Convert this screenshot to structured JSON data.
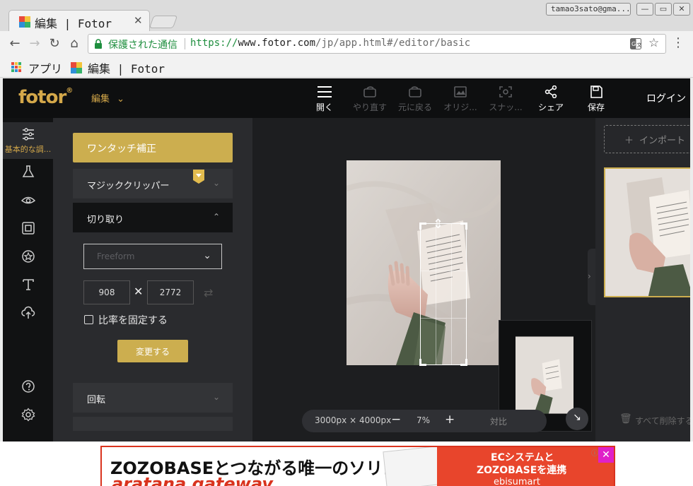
{
  "browser": {
    "tab_title": "編集 | Fotor",
    "tab_close": "✕",
    "user": "tamao3sato@gma...",
    "window_buttons": [
      "—",
      "▭",
      "✕"
    ],
    "secure_label": "保護された通信",
    "url_scheme": "https://",
    "url_host": "www.fotor.com",
    "url_path": "/jp/app.html#/editor/basic",
    "bookmarks": {
      "apps_label": "アプリ",
      "fotor_label": "編集 | Fotor"
    }
  },
  "app": {
    "logo": "fotor",
    "logo_mark": "®",
    "edit_menu": "編集",
    "toolbar": [
      {
        "label": "開く",
        "icon": "menu-icon",
        "enabled": true
      },
      {
        "label": "やり直す",
        "icon": "redo-icon",
        "enabled": false
      },
      {
        "label": "元に戻る",
        "icon": "undo-icon",
        "enabled": false
      },
      {
        "label": "オリジ...",
        "icon": "original-icon",
        "enabled": false
      },
      {
        "label": "スナッ...",
        "icon": "snapshot-icon",
        "enabled": false
      },
      {
        "label": "シェア",
        "icon": "share-icon",
        "enabled": true
      },
      {
        "label": "保存",
        "icon": "save-icon",
        "enabled": true
      }
    ],
    "login": "ログイン",
    "rail": {
      "active_label": "基本的な調..."
    },
    "panel": {
      "one_touch": "ワンタッチ補正",
      "magic_clipper": "マジッククリッパー",
      "crop": "切り取り",
      "select_value": "Freeform",
      "width": "908",
      "height": "2772",
      "times": "✕",
      "lock_ratio": "比率を固定する",
      "apply": "変更する",
      "rotate": "回転"
    },
    "canvas": {
      "size_text": "3000px × 4000px",
      "zoom": "7%",
      "minus": "−",
      "plus": "+",
      "compare": "対比"
    },
    "right": {
      "import": "インポート",
      "delete_all": "すべて削除する"
    },
    "accent": "#ccae4f"
  },
  "ad": {
    "headline": "ZOZOBASEとつながる唯一のソリューション",
    "sub": "aratana gateway",
    "right_1": "ECシステムと",
    "right_2": "ZOZOBASEを連携",
    "right_3": "ebisumart",
    "close": "✕"
  }
}
